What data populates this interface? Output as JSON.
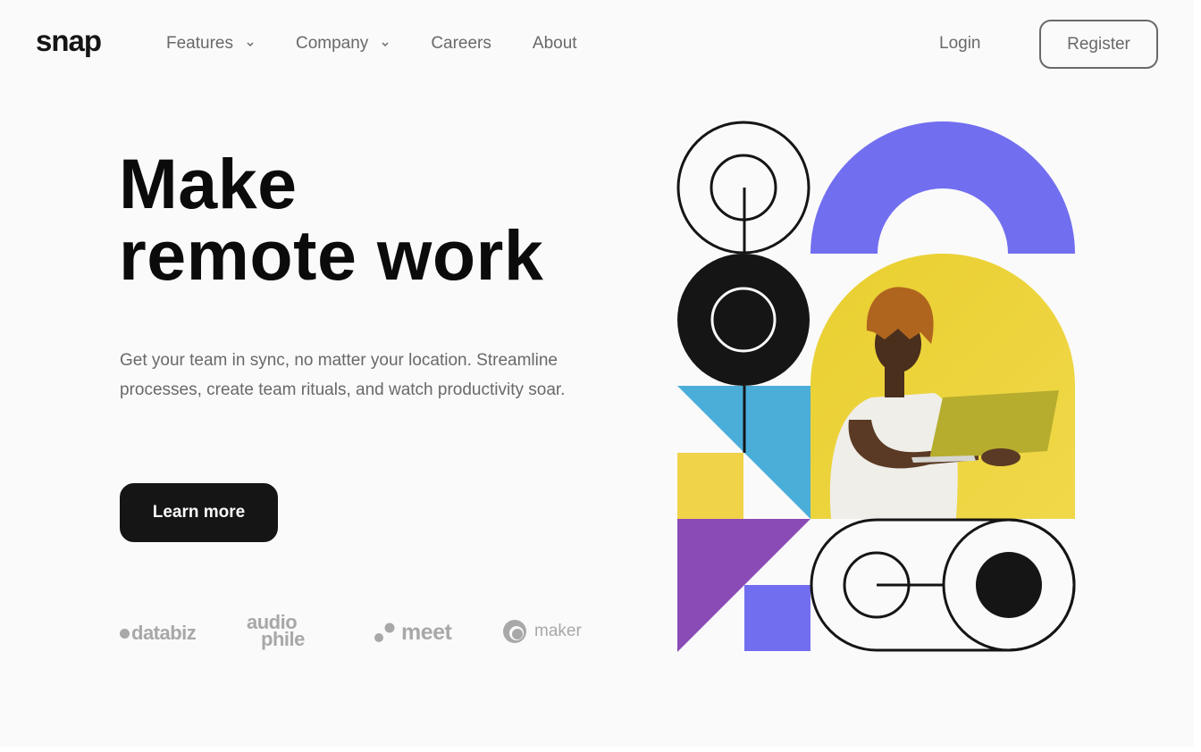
{
  "header": {
    "logo": "snap",
    "nav": [
      {
        "label": "Features",
        "has_dropdown": true
      },
      {
        "label": "Company",
        "has_dropdown": true
      },
      {
        "label": "Careers",
        "has_dropdown": false
      },
      {
        "label": "About",
        "has_dropdown": false
      }
    ],
    "login_label": "Login",
    "register_label": "Register"
  },
  "hero": {
    "title_line1": "Make",
    "title_line2": "remote work",
    "description": "Get your team in sync, no matter your location. Streamline processes, create team rituals, and watch productivity soar.",
    "cta_label": "Learn more"
  },
  "clients": {
    "databiz": "databiz",
    "audiophile_line1": "audio",
    "audiophile_line2": "phile",
    "meet": "meet",
    "maker": "maker"
  },
  "illustration": {
    "description": "Geometric illustration with person holding laptop",
    "colors": {
      "purple": "#726ef0",
      "yellow": "#f1d34a",
      "blue": "#4aaed9",
      "violet": "#8b4bb6",
      "black": "#151515",
      "photo_bg": "#e9cf2f"
    }
  },
  "theme": {
    "background": "#fafafa",
    "text_dark": "#151515",
    "text_muted": "#696969",
    "logo_gray": "#a8a8a8"
  }
}
